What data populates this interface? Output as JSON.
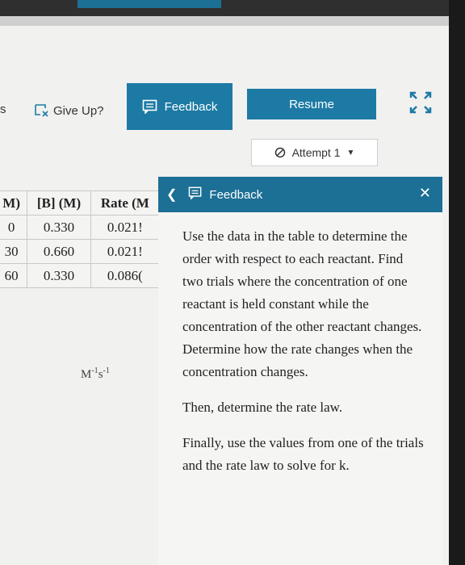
{
  "toolbar": {
    "cut_label": "s",
    "give_up_label": "Give Up?",
    "feedback_label": "Feedback",
    "resume_label": "Resume"
  },
  "attempt": {
    "label": "Attempt 1"
  },
  "table": {
    "headers": [
      "M)",
      "[B] (M)",
      "Rate (M"
    ],
    "rows": [
      [
        "0",
        "0.330",
        "0.021!"
      ],
      [
        "30",
        "0.660",
        "0.021!"
      ],
      [
        "60",
        "0.330",
        "0.086("
      ]
    ]
  },
  "units": {
    "base": "M",
    "exp1": "-1",
    "mid": "s",
    "exp2": "-1"
  },
  "feedback_panel": {
    "title": "Feedback",
    "paragraphs": [
      "Use the data in the table to determine the order with respect to each reactant. Find two trials where the concentration of one reactant is held constant while the concentration of the other reactant changes. Determine how the rate changes when the concentration changes.",
      "Then, determine the rate law.",
      "Finally, use the values from one of the trials and the rate law to solve for k."
    ]
  },
  "colors": {
    "accent": "#1c7aa4",
    "panel_header": "#1c6f95"
  }
}
